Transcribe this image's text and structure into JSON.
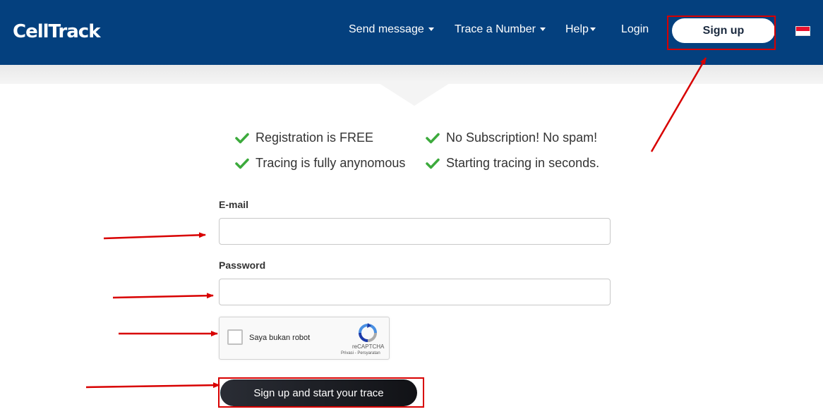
{
  "header": {
    "logo": "CellTrack",
    "nav": {
      "send_message": "Send message",
      "trace_number": "Trace a Number",
      "help": "Help",
      "login": "Login"
    },
    "signup_label": "Sign up",
    "language_flag": "indonesia-flag",
    "brand_color": "#04407e"
  },
  "benefits": {
    "b1": "Registration is FREE",
    "b2": "No Subscription! No spam!",
    "b3": "Tracing is fully anynomous",
    "b4": "Starting tracing in seconds."
  },
  "form": {
    "email_label": "E-mail",
    "email_value": "",
    "password_label": "Password",
    "password_value": "",
    "captcha": {
      "text": "Saya bukan robot",
      "brand": "reCAPTCHA",
      "links": "Privasi - Persyaratan"
    },
    "submit_label": "Sign up and start your trace"
  },
  "colors": {
    "check": "#3caa3c",
    "annotation": "#d80000"
  }
}
